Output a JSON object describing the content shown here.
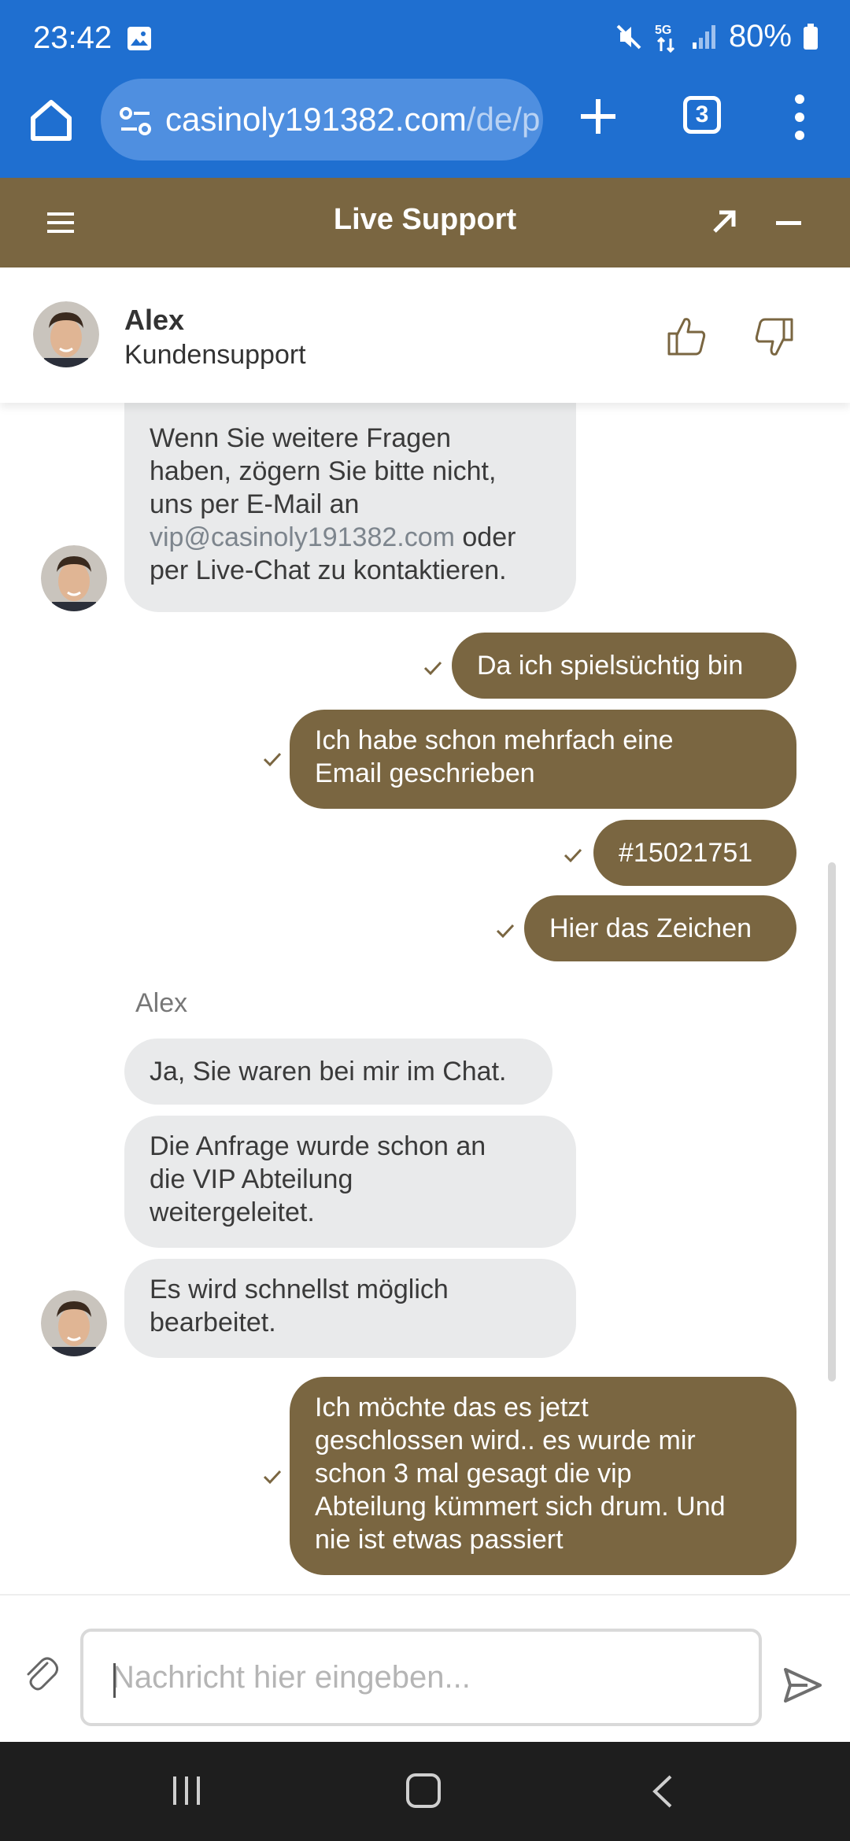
{
  "status_bar": {
    "time": "23:42",
    "battery": "80%",
    "icons": [
      "gallery-icon",
      "mute-icon",
      "5g-icon",
      "signal-icon",
      "battery-icon"
    ]
  },
  "browser": {
    "url_main": "casinoly191382.com",
    "url_path": "/de/p",
    "tab_count": "3"
  },
  "support_header": {
    "title": "Live Support"
  },
  "agent": {
    "name": "Alex",
    "role": "Kundensupport"
  },
  "messages": {
    "m1_line1": "Wenn Sie weitere Fragen",
    "m1_line2": "haben, zögern Sie bitte nicht,",
    "m1_line3": "uns per E-Mail an",
    "m1_email": "vip@casinoly191382.com",
    "m1_oder": " oder",
    "m1_line5": "per Live-Chat zu kontaktieren.",
    "u1": "Da ich spielsüchtig bin",
    "u2_line1": "Ich habe schon mehrfach eine",
    "u2_line2": "Email geschrieben",
    "u3": "#15021751",
    "u4": "Hier das Zeichen",
    "sender": "Alex",
    "a2": "Ja, Sie waren bei mir im Chat.",
    "a3_line1": "Die Anfrage wurde schon an",
    "a3_line2": "die VIP Abteilung",
    "a3_line3": "weitergeleitet.",
    "a4_line1": "Es wird schnellst möglich",
    "a4_line2": "bearbeitet.",
    "u5_line1": "Ich möchte das es jetzt",
    "u5_line2": "geschlossen wird.. es wurde mir",
    "u5_line3": "schon 3 mal gesagt die vip",
    "u5_line4": "Abteilung kümmert sich drum. Und",
    "u5_line5": "nie ist etwas passiert"
  },
  "input": {
    "placeholder": "Nachricht hier eingeben...",
    "value": ""
  },
  "colors": {
    "browser_blue": "#1f6fd0",
    "brand_brown": "#7a6641",
    "agent_bubble": "#e9eaeb"
  }
}
